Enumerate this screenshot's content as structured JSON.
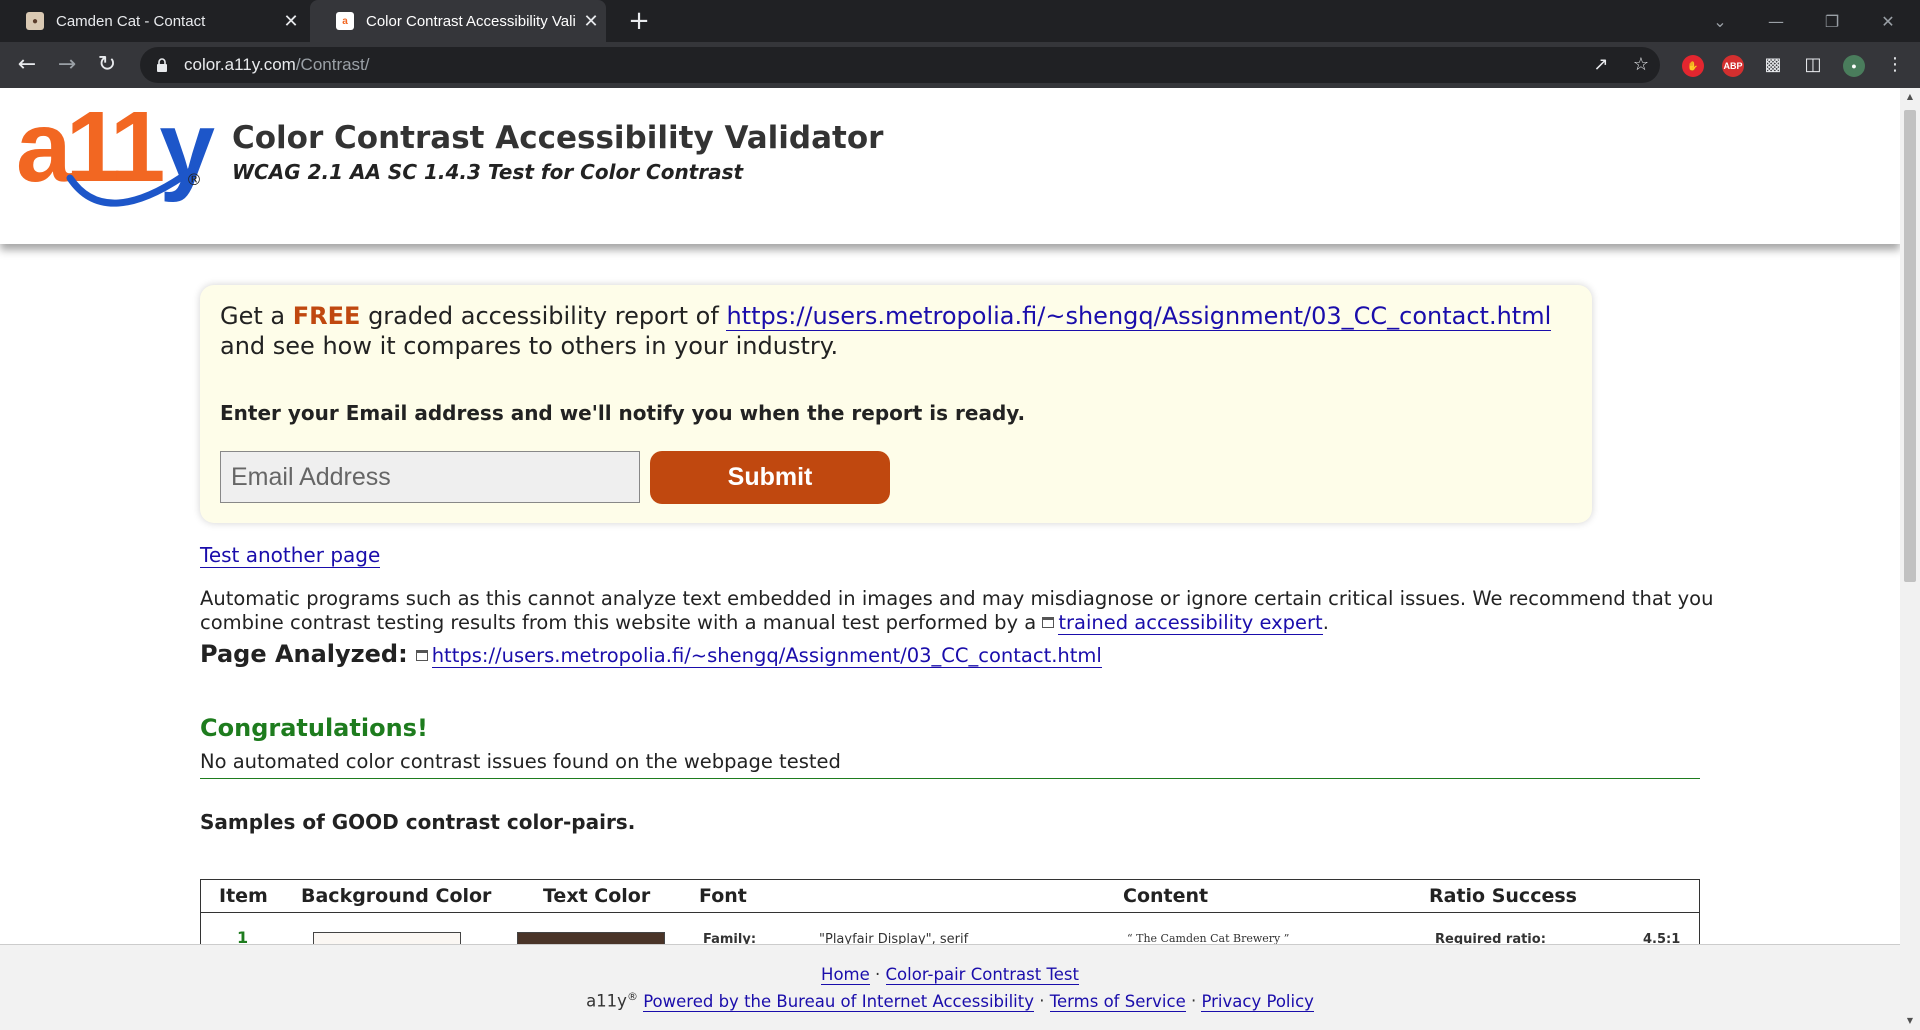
{
  "browser": {
    "tabs": [
      {
        "title": "Camden Cat - Contact",
        "active": false
      },
      {
        "title": "Color Contrast Accessibility Valid",
        "active": true
      }
    ],
    "address": {
      "host": "color.a11y.com",
      "path": "/Contrast/"
    },
    "colors": {
      "tabbar": "#202124",
      "toolbar": "#35363a"
    }
  },
  "header": {
    "logo_text": "a11y",
    "logo_reg": "®",
    "title": "Color Contrast Accessibility Validator",
    "subtitle": "WCAG 2.1 AA SC 1.4.3 Test for Color Contrast"
  },
  "promo": {
    "get_a": "Get a",
    "free": "FREE",
    "graded_text": "graded accessibility report of",
    "report_url": "https://users.metropolia.fi/~shengq/Assignment/03_CC_contact.html",
    "compare_text": "and see how it compares to others in your industry.",
    "notify_text": "Enter your Email address and we'll notify you when the report is ready.",
    "email_placeholder": "Email Address",
    "submit_label": "Submit",
    "accent_color": "#c0480f",
    "background_color": "#fefde9"
  },
  "content": {
    "test_another": "Test another page",
    "disclaimer_text": "Automatic programs such as this cannot analyze text embedded in images and may misdiagnose or ignore certain critical issues. We recommend that you combine contrast testing results from this website with a manual test performed by a",
    "expert_link": "trained accessibility expert",
    "disclaimer_end": ".",
    "page_analyzed_label": "Page Analyzed:",
    "page_analyzed_url": "https://users.metropolia.fi/~shengq/Assignment/03_CC_contact.html",
    "congrats": "Congratulations!",
    "no_issues": "No automated color contrast issues found on the webpage tested",
    "samples_title": "Samples of GOOD contrast color-pairs."
  },
  "table": {
    "headers": [
      "Item",
      "Background Color",
      "Text Color",
      "Font",
      "Content",
      "Ratio Success"
    ],
    "row1": {
      "item": "1",
      "background_color": "#fbf7f3",
      "text_color": "#4a3428",
      "font_label": "Family:",
      "font_value": "\"Playfair Display\", serif",
      "content": "The Camden Cat Brewery",
      "ratio_label": "Required ratio:",
      "ratio_value": "4.5:1"
    }
  },
  "footer": {
    "home": "Home",
    "sep": "·",
    "colorpair": "Color-pair Contrast Test",
    "brand": "a11y",
    "brand_reg": "®",
    "powered": "Powered by the Bureau of Internet Accessibility",
    "terms": "Terms of Service",
    "privacy": "Privacy Policy"
  }
}
